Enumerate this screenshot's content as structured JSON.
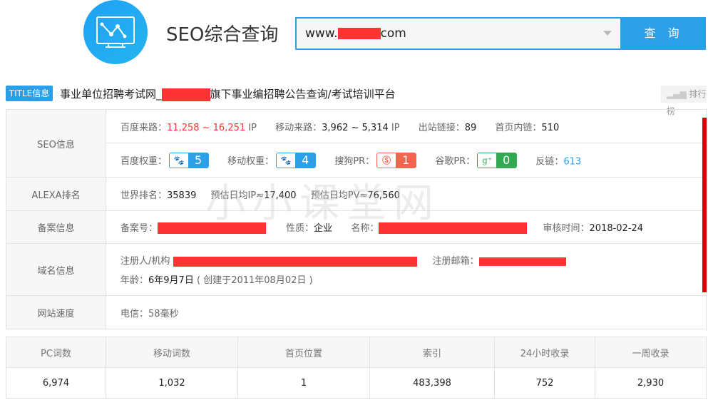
{
  "header": {
    "title": "SEO综合查询",
    "search_prefix": "www.",
    "search_suffix": "com",
    "query_button": "查 询"
  },
  "title_row": {
    "badge": "TITLE信息",
    "title_start": "事业单位招聘考试网_",
    "title_end": "旗下事业编招聘公告查询/考试培训平台",
    "ranking_button": "排行榜"
  },
  "watermark": "小小课堂网",
  "seo": {
    "label": "SEO信息",
    "baidu_traffic_label": "百度来路：",
    "baidu_traffic": "11,258 ~ 16,251",
    "ip_unit": "IP",
    "mobile_traffic_label": "移动来路：",
    "mobile_traffic": "3,962 ~ 5,314",
    "outbound_label": "出站链接：",
    "outbound": "89",
    "home_internal_label": "首页内链：",
    "home_internal": "510",
    "baidu_weight_label": "百度权重：",
    "baidu_weight": "5",
    "mobile_weight_label": "移动权重：",
    "mobile_weight": "4",
    "sogou_pr_label": "搜狗PR：",
    "sogou_pr": "1",
    "google_pr_label": "谷歌PR：",
    "google_pr": "0",
    "backlinks_label": "反链：",
    "backlinks": "613"
  },
  "alexa": {
    "label": "ALEXA排名",
    "world_label": "世界排名：",
    "world": "35839",
    "ip_label": "预估日均IP≈",
    "ip": "17,400",
    "pv_label": "预估日均PV≈",
    "pv": "76,560"
  },
  "icp": {
    "label": "备案信息",
    "no_label": "备案号：",
    "type_label": "性质：",
    "type": "企业",
    "name_label": "名称：",
    "date_label": "审核时间：",
    "date": "2018-02-24"
  },
  "domain": {
    "label": "域名信息",
    "registrant_label": "注册人/机构",
    "email_label": "注册邮箱：",
    "age_label": "年龄：",
    "age": "6年9月7日",
    "created": "( 创建于2011年08月02日 )"
  },
  "speed": {
    "label": "网站速度",
    "value": "电信：58毫秒"
  },
  "stats": {
    "headers": [
      "PC词数",
      "移动词数",
      "首页位置",
      "索引",
      "24小时收录",
      "一周收录"
    ],
    "values": [
      "6,974",
      "1,032",
      "1",
      "483,398",
      "752",
      "2,930"
    ]
  },
  "colors": {
    "accent": "#2d9ee8",
    "red": "#ff3333",
    "baidu": "#2d9ee8",
    "sogou": "#f4644f",
    "google": "#34a853"
  }
}
